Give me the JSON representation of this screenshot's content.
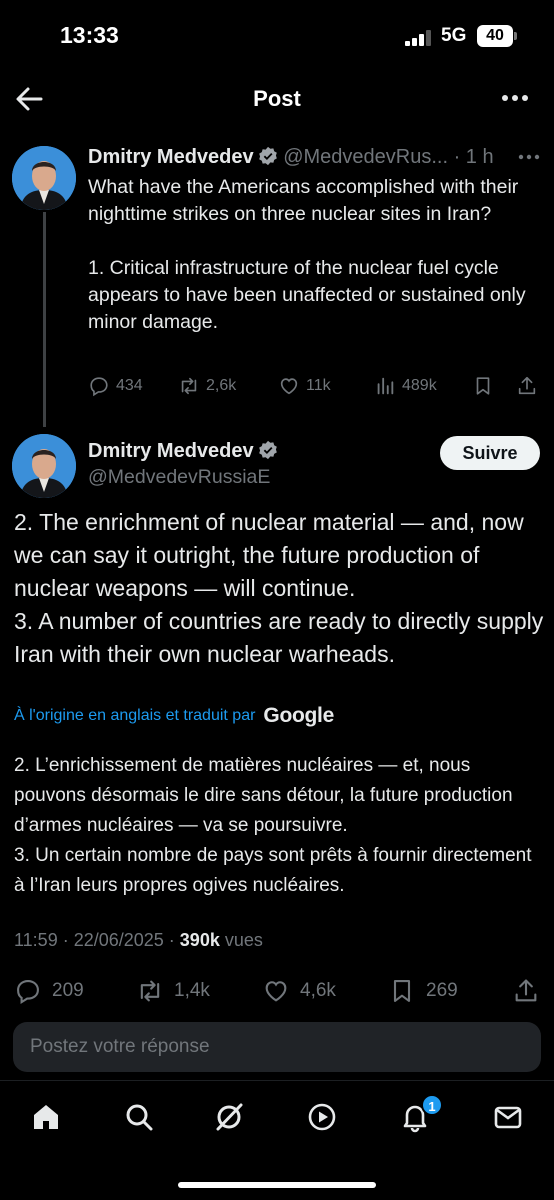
{
  "status_bar": {
    "time": "13:33",
    "network": "5G",
    "battery": "40"
  },
  "header": {
    "title": "Post"
  },
  "reply_tweet": {
    "name": "Dmitry Medvedev",
    "handle": "@MedvedevRus...",
    "time": "· 1 h",
    "text": "What have the Americans accomplished with their nighttime strikes on three nuclear sites in Iran?\n\n1. Critical infrastructure of the nuclear fuel cycle appears to have been unaffected or sustained only minor damage.",
    "replies": "434",
    "reposts": "2,6k",
    "likes": "11k",
    "views": "489k"
  },
  "main_tweet": {
    "name": "Dmitry Medvedev",
    "handle": "@MedvedevRussiaE",
    "follow_label": "Suivre",
    "line1": "2. The enrichment of nuclear material — and, now we can say it outright, the future production of nuclear weapons — will continue.",
    "line2": "3. A number of countries are ready to directly supply Iran with their own nuclear warheads.",
    "translated_by": "À l'origine en anglais et traduit par",
    "translator": "Google",
    "trans_line1": "2. L’enrichissement de matières nucléaires — et, nous pouvons désormais le dire sans détour, la future production d’armes nucléaires — va se poursuivre.",
    "trans_line2": "3. Un certain nombre de pays sont prêts à fournir directement à l’Iran leurs propres ogives nucléaires.",
    "timestamp": "11:59 · 22/06/2025 · ",
    "views_count": "390k",
    "views_label": " vues",
    "replies": "209",
    "reposts": "1,4k",
    "likes": "4,6k",
    "bookmarks": "269"
  },
  "reply_input": {
    "placeholder": "Postez votre réponse"
  },
  "tabbar": {
    "notifications_badge": "1"
  },
  "colors": {
    "accent": "#1d9bf0",
    "muted": "#71767b",
    "text": "#e7e9ea",
    "background": "#000000"
  }
}
